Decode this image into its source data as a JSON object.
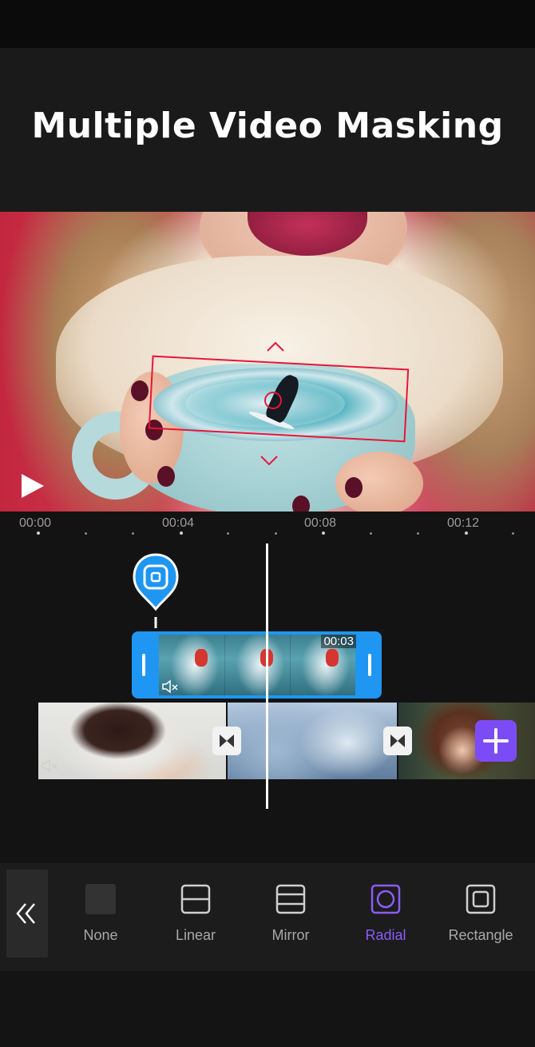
{
  "title": "Multiple Video Masking",
  "colors": {
    "accent": "#8a5cf6",
    "overlay_clip": "#1f96f2",
    "mask_outline": "#e5173a",
    "add_button": "#7b4cf5"
  },
  "ruler": {
    "labels": [
      "00:00",
      "00:04",
      "00:08",
      "00:12"
    ]
  },
  "overlay": {
    "duration": "00:03"
  },
  "masks": {
    "options": [
      {
        "label": "None",
        "icon": "none-mask-icon"
      },
      {
        "label": "Linear",
        "icon": "linear-mask-icon"
      },
      {
        "label": "Mirror",
        "icon": "mirror-mask-icon"
      },
      {
        "label": "Radial",
        "icon": "radial-mask-icon"
      },
      {
        "label": "Rectangle",
        "icon": "rectangle-mask-icon"
      }
    ],
    "selected": "Radial"
  }
}
